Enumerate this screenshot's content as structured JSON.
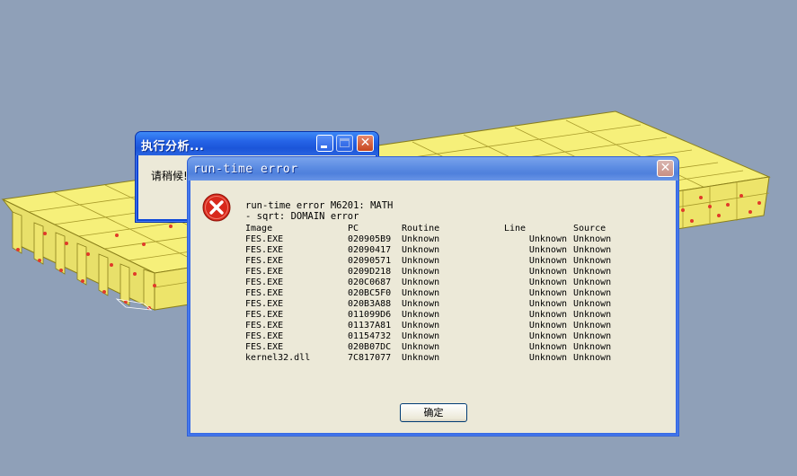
{
  "background_window": {
    "title": "执行分析...",
    "message": "请稍候!",
    "buttons": {
      "minimize": "minimize",
      "maximize": "maximize",
      "close": "close"
    }
  },
  "error_dialog": {
    "title": "run-time error",
    "icon": "error-icon",
    "message_line1": "run-time error M6201: MATH",
    "message_line2": "- sqrt: DOMAIN error",
    "columns": [
      "Image",
      "PC",
      "Routine",
      "Line",
      "Source"
    ],
    "rows": [
      [
        "FES.EXE",
        "020905B9",
        "Unknown",
        "Unknown",
        "Unknown"
      ],
      [
        "FES.EXE",
        "02090417",
        "Unknown",
        "Unknown",
        "Unknown"
      ],
      [
        "FES.EXE",
        "02090571",
        "Unknown",
        "Unknown",
        "Unknown"
      ],
      [
        "FES.EXE",
        "0209D218",
        "Unknown",
        "Unknown",
        "Unknown"
      ],
      [
        "FES.EXE",
        "020C0687",
        "Unknown",
        "Unknown",
        "Unknown"
      ],
      [
        "FES.EXE",
        "020BC5F0",
        "Unknown",
        "Unknown",
        "Unknown"
      ],
      [
        "FES.EXE",
        "020B3A88",
        "Unknown",
        "Unknown",
        "Unknown"
      ],
      [
        "FES.EXE",
        "011099D6",
        "Unknown",
        "Unknown",
        "Unknown"
      ],
      [
        "FES.EXE",
        "01137A81",
        "Unknown",
        "Unknown",
        "Unknown"
      ],
      [
        "FES.EXE",
        "01154732",
        "Unknown",
        "Unknown",
        "Unknown"
      ],
      [
        "FES.EXE",
        "020B07DC",
        "Unknown",
        "Unknown",
        "Unknown"
      ],
      [
        "kernel32.dll",
        "7C817077",
        "Unknown",
        "Unknown",
        "Unknown"
      ]
    ],
    "ok_label": "确定"
  },
  "colors": {
    "desktop": "#8fa0b8",
    "model_fill": "#f6f07a",
    "model_edge": "#8a7f1a",
    "node_marker": "#e03a2a"
  }
}
